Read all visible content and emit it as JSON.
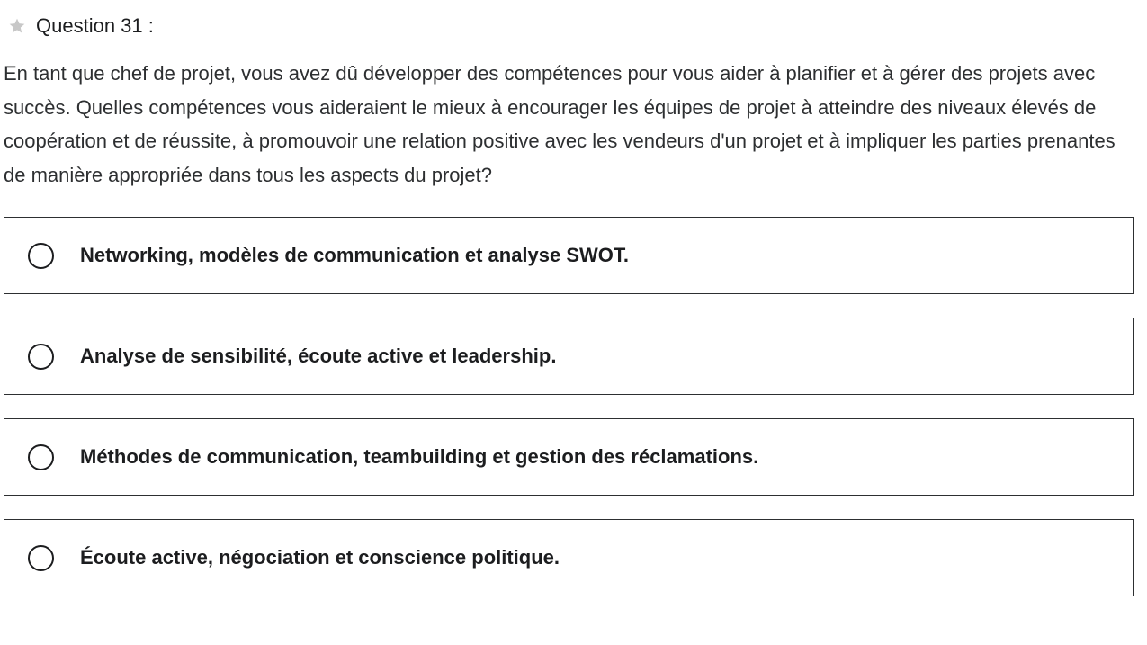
{
  "question": {
    "star_icon": "star-icon",
    "label": "Question 31 :",
    "text": "En tant que chef de projet, vous avez dû développer des compétences pour vous aider à planifier et à gérer des projets avec succès. Quelles compétences vous aideraient le mieux à encourager les équipes de projet à atteindre des niveaux élevés de coopération et de réussite, à promouvoir une relation positive avec les vendeurs d'un projet et à impliquer les parties prenantes de manière appropriée dans tous les aspects du projet?"
  },
  "options": [
    {
      "label": "Networking, modèles de communication et analyse SWOT.",
      "selected": false
    },
    {
      "label": "Analyse de sensibilité, écoute active et leadership.",
      "selected": false
    },
    {
      "label": "Méthodes de communication, teambuilding et gestion des réclamations.",
      "selected": false
    },
    {
      "label": "Écoute active, négociation et conscience politique.",
      "selected": false
    }
  ],
  "colors": {
    "star": "#c8c8c8",
    "text": "#1c1d1f",
    "border": "#2d2f31"
  }
}
